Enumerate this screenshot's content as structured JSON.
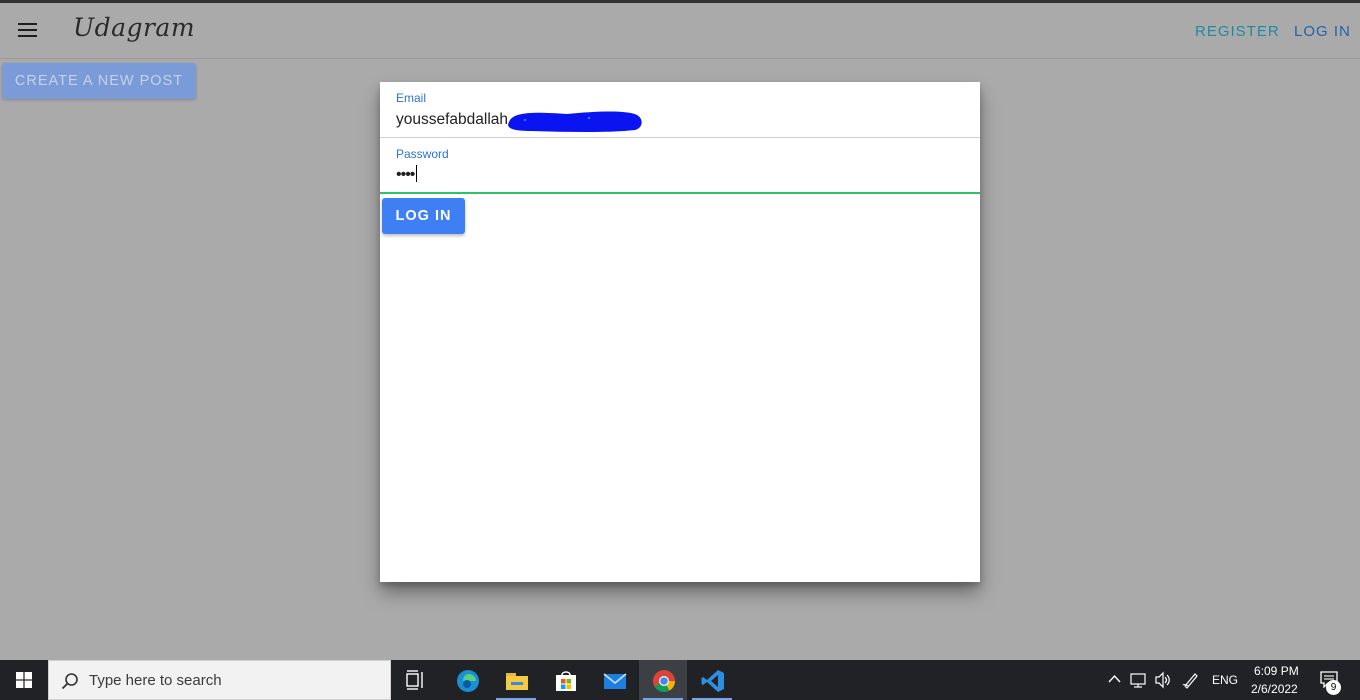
{
  "app": {
    "brand": "Udagram",
    "nav": {
      "register_label": "REGISTER",
      "login_label": "LOG IN"
    },
    "create_post_label": "CREATE A NEW POST"
  },
  "login_modal": {
    "email_label": "Email",
    "email_value": "youssefabdallah",
    "password_label": "Password",
    "password_value": "••••",
    "submit_label": "LOG IN"
  },
  "taskbar": {
    "search_placeholder": "Type here to search",
    "apps": [
      "task-view-icon",
      "edge-icon",
      "file-explorer-icon",
      "store-icon",
      "mail-icon",
      "chrome-icon",
      "vscode-icon"
    ],
    "language": "ENG",
    "time": "6:09 PM",
    "date": "2/6/2022",
    "notification_count": "9"
  },
  "colors": {
    "accent": "#3e80f4",
    "register_link": "#1f8aa0",
    "login_link": "#2062ad",
    "focus_underline": "#2fc26b",
    "redaction": "#0a14f0"
  }
}
